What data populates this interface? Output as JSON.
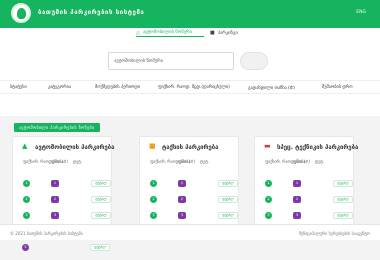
{
  "header": {
    "title": "ბათუმის პარკირების სისტემა",
    "lang": "ENG",
    "bg_color": "#16b45e"
  },
  "tabs": [
    {
      "label": "ავტომობილის ნომერი",
      "icon": "car-icon"
    },
    {
      "label": "პარკინგი",
      "icon": "parking-icon"
    }
  ],
  "search": {
    "value": "ავტომობილის ნომერი"
  },
  "nav": [
    "სტატუსი",
    "კატეგორია",
    "მოქმედების პერიოდი",
    "ფიქსირ. რაოდ. მცდ.(დარიცხული)",
    "გადახდილი თანხა (₾)",
    "მუშაობის დრო"
  ],
  "section": {
    "label": "ავტომობილი პარკირების ზონები"
  },
  "cards": [
    {
      "title": "ავტომობილის პარკირება",
      "icon": "car-icon",
      "icon_color": "#16b45e",
      "col1": "ფიქსირ. რაოდენობა",
      "col2": "ფასი (₾)",
      "col3": "დეტ.",
      "rows": [
        {
          "num": "1",
          "rate": "1",
          "btn": "დეტალ"
        },
        {
          "num": "2",
          "rate": "2",
          "btn": "დეტალ"
        },
        {
          "num": "3",
          "rate": "3",
          "btn": "დეტალ"
        },
        {
          "num": "5",
          "rate": "5",
          "btn": "დეტალ"
        }
      ],
      "dot_color": "#16b45e"
    },
    {
      "title": "ტაქსის პარკირება",
      "icon": "taxi-icon",
      "icon_color": "#f0a11e",
      "col1": "ფიქსირ. რაოდენობა",
      "col2": "ფასი (₾)",
      "col3": "დეტ.",
      "rows": [
        {
          "num": "1",
          "rate": "1",
          "btn": "დეტალ"
        },
        {
          "num": "2",
          "rate": "2",
          "btn": "დეტალ"
        },
        {
          "num": "3",
          "rate": "3",
          "btn": "დეტალ"
        },
        {
          "num": "5",
          "rate": "5",
          "btn": "დეტალ"
        }
      ],
      "dot_color": "#16b45e"
    },
    {
      "title": "სპეც. ტექნიკის პარკირება",
      "icon": "truck-icon",
      "icon_color": "#e03a3a",
      "col1": "ფიქსირ. რაოდენობა",
      "col2": "ფასი (₾)",
      "col3": "დეტ.",
      "rows": [
        {
          "num": "1",
          "rate": "1",
          "btn": "დეტალ"
        },
        {
          "num": "2",
          "rate": "2",
          "btn": "დეტალ"
        },
        {
          "num": "3",
          "rate": "3",
          "btn": "დეტალ"
        },
        {
          "num": "5",
          "rate": "5",
          "btn": "დეტალ"
        }
      ],
      "dot_color": "#16b45e"
    }
  ],
  "footer": {
    "left": "© 2021 ბათუმის პარკირების სისტემა",
    "right": "მუნიციპალური სერვისების სააგენტო"
  },
  "colors": {
    "accent": "#16b45e",
    "rate": "#7b3aa8"
  }
}
